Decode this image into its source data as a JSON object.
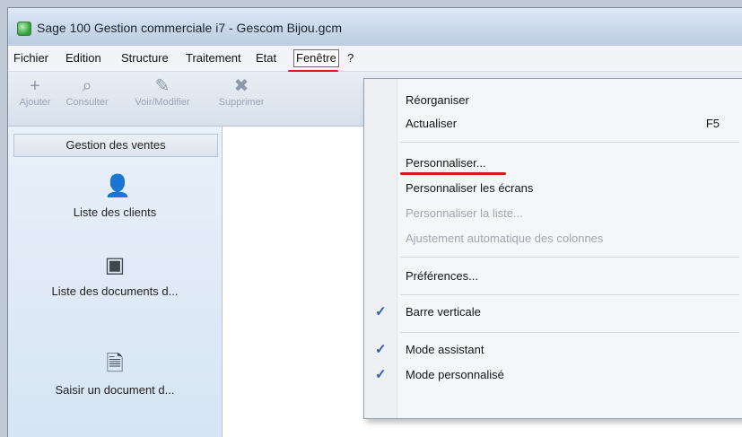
{
  "window": {
    "title": "Sage 100 Gestion commerciale i7 - Gescom Bijou.gcm"
  },
  "menubar": {
    "items": [
      {
        "label": "Fichier"
      },
      {
        "label": "Edition"
      },
      {
        "label": "Structure"
      },
      {
        "label": "Traitement"
      },
      {
        "label": "Etat"
      },
      {
        "label": "Fenêtre"
      },
      {
        "label": "?"
      }
    ]
  },
  "toolbar": {
    "buttons": [
      {
        "label": "Ajouter",
        "icon": "plus-icon"
      },
      {
        "label": "Consulter",
        "icon": "search-icon"
      },
      {
        "label": "Voir/Modifier",
        "icon": "pencil-icon"
      },
      {
        "label": "Supprimer",
        "icon": "delete-icon"
      }
    ]
  },
  "sidebar": {
    "header": "Gestion des ventes",
    "items": [
      {
        "label": "Liste des clients",
        "icon": "person-icon"
      },
      {
        "label": "Liste des documents d...",
        "icon": "document-list-icon"
      },
      {
        "label": "Saisir un document d...",
        "icon": "new-document-icon"
      }
    ]
  },
  "dropdown": {
    "items": [
      {
        "label": "Réorganiser",
        "enabled": true
      },
      {
        "label": "Actualiser",
        "shortcut": "F5",
        "enabled": true
      },
      {
        "label": "Personnaliser...",
        "enabled": true,
        "highlighted": true
      },
      {
        "label": "Personnaliser les écrans",
        "enabled": true
      },
      {
        "label": "Personnaliser la liste...",
        "enabled": false
      },
      {
        "label": "Ajustement automatique des colonnes",
        "enabled": false
      },
      {
        "label": "Préférences...",
        "enabled": true
      },
      {
        "label": "Barre verticale",
        "enabled": true,
        "checked": true
      },
      {
        "label": "Mode assistant",
        "enabled": true,
        "checked": true
      },
      {
        "label": "Mode personnalisé",
        "enabled": true,
        "checked": true
      }
    ]
  },
  "colors": {
    "annotation_red": "#d21a1a",
    "check_blue": "#2a5fb0"
  }
}
